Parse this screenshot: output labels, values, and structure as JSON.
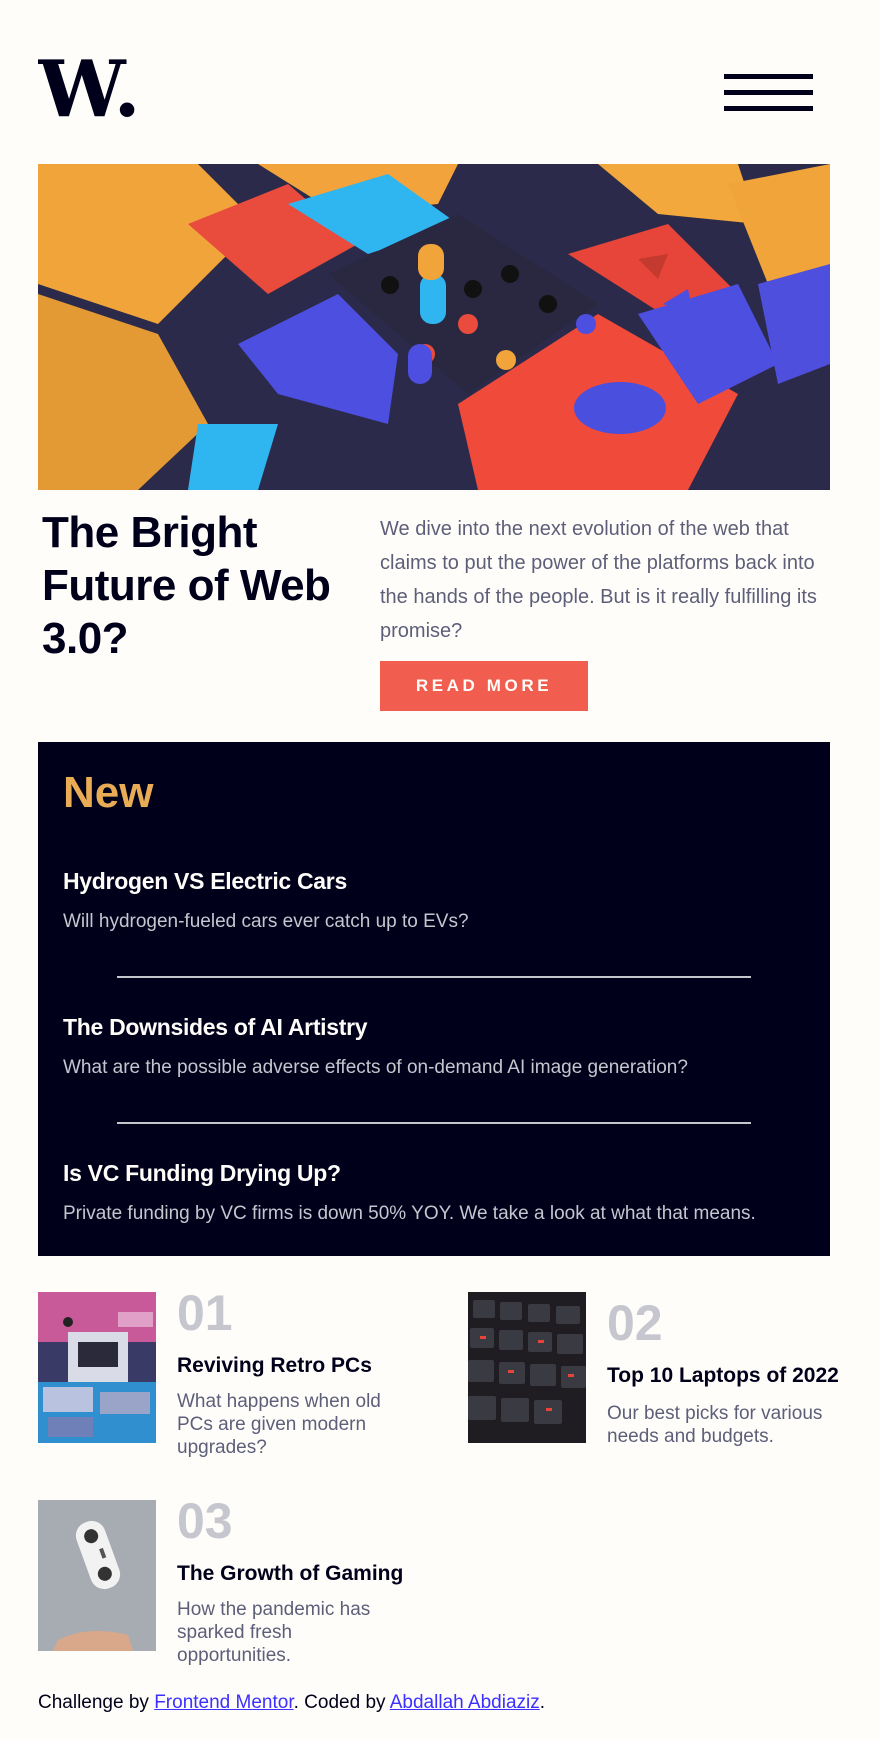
{
  "header": {
    "logo_text": "W.",
    "menu_icon": "hamburger-menu-icon"
  },
  "hero": {
    "image": "3d-abstract-blocks-image",
    "title": "The Bright Future of Web 3.0?",
    "description": "We dive into the next evolution of the web that claims to put the power of the platforms back into the hands of the people. But is it really fulfilling its promise?",
    "button_label": "READ MORE"
  },
  "new_section": {
    "title": "New",
    "items": [
      {
        "title": "Hydrogen VS Electric Cars",
        "description": "Will hydrogen-fueled cars ever catch up to EVs?"
      },
      {
        "title": "The Downsides of AI Artistry",
        "description": "What are the possible adverse effects of on-demand AI image generation?"
      },
      {
        "title": "Is VC Funding Drying Up?",
        "description": "Private funding by VC firms is down 50% YOY. We take a look at what that means."
      }
    ]
  },
  "articles": [
    {
      "number": "01",
      "title": "Reviving Retro PCs",
      "description": "What happens when old PCs are given modern upgrades?",
      "image": "retro-pc-image"
    },
    {
      "number": "02",
      "title": "Top 10 Laptops of 2022",
      "description": "Our best picks for various needs and budgets.",
      "image": "laptop-keyboard-image"
    },
    {
      "number": "03",
      "title": "The Growth of Gaming",
      "description": "How the pandemic has sparked fresh opportunities.",
      "image": "gaming-controller-image"
    }
  ],
  "footer": {
    "prefix": "Challenge by ",
    "link1": "Frontend Mentor",
    "middle": ". Coded by ",
    "link2": "Abdallah Abdiaziz",
    "suffix": "."
  },
  "colors": {
    "background": "#fffdfa",
    "dark_navy": "#00001a",
    "soft_red": "#f15e50",
    "soft_orange": "#e9ab53",
    "grayish_blue": "#c5c6ce",
    "dark_grayish_blue": "#5d5f79",
    "link_blue": "#3b30ff"
  }
}
